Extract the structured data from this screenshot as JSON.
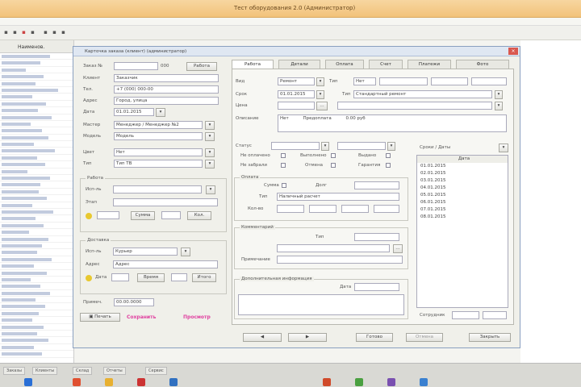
{
  "window": {
    "title": "Тест оборудования 2.0 (Администратор)"
  },
  "left_panel": {
    "header": "Наименов.",
    "row_count": 45
  },
  "dialog": {
    "title": "Карточка заказа (клиент) (администратор)",
    "left": {
      "order_label": "Заказ №",
      "order_value": "",
      "order_suffix": "000",
      "status_button": "Работа",
      "client_label": "Клиент",
      "client_value": "Заказчик",
      "phone_label": "Тел.",
      "phone_value": "+7 (000) 000-00",
      "address_label": "Адрес",
      "address_value": "Город, улица",
      "date_label": "Дата",
      "date_value": "01.01.2015",
      "master_label": "Мастер",
      "master_value": "Менеджер / Менеджер №2",
      "model_label": "Модель",
      "model_value": "Модель",
      "color_label": "Цвет",
      "color_value": "Нет",
      "type_label": "Тип",
      "type_value": "Тип ТВ",
      "group1_title": "Работа",
      "g1_field1": "Исп-ль",
      "g1_field2": "Этап",
      "g1_field3": "Сумма",
      "g1_field4": "Кол.",
      "group2_title": "Доставка",
      "g2_field1": "Исп-ль",
      "g2_field1_value": "Курьер",
      "g2_field2": "Адрес",
      "g2_field2_value": "Адрес",
      "g2_field3": "Дата",
      "g2_field4": "Время",
      "g2_field5": "Итого",
      "comment_label": "Примеч.",
      "comment_value": "00.00.0000",
      "print_button": "Печать",
      "save_link": "Сохранить",
      "print_link": "Просмотр"
    },
    "tabs": [
      "Работа",
      "Детали",
      "Оплата",
      "Счет",
      "Платежи",
      "Фото"
    ],
    "tab_panel": {
      "f1_label": "Вид",
      "f1_value": "Ремонт",
      "f1_side_label": "Тип",
      "f1_side_value": "Нет",
      "f2_label": "Срок",
      "f2_value": "01.01.2015",
      "f2_side_label": "Тип",
      "f2_side_value": "Стандартный ремонт",
      "f3_label": "Цена",
      "f3_value": "",
      "f4_label": "Описание",
      "f4_value": "Нет",
      "f4_extra": "Предоплата",
      "f4_extra2": "0.00 руб",
      "status_label": "Статус",
      "status_value": "",
      "right_group_title": "Сроки / Даты",
      "dates_header": "Дата",
      "dates": [
        "01.01.2015",
        "02.01.2015",
        "03.01.2015",
        "04.01.2015",
        "05.01.2015",
        "06.01.2015",
        "07.01.2015",
        "08.01.2015"
      ],
      "chk1": "Не оплачено",
      "chk2": "Выполнено",
      "chk3": "Выдано",
      "chk4": "Не забрали",
      "chk5": "Отмена",
      "chk6": "Гарантия",
      "group3_title": "Оплата",
      "g3_f1": "Сумма",
      "g3_f1_side": "Долг",
      "g3_f2": "Тип",
      "g3_f2_value": "Наличный расчет",
      "g3_f3": "Кол-во",
      "group4_title": "Комментарий",
      "g4_f1": "Тип",
      "g4_f2": "Примечание",
      "group5_title": "Дополнительная информация",
      "g5_f1": "Дата",
      "bottom_label": "Сотрудник"
    },
    "buttons": {
      "prev": "◀",
      "next": "▶",
      "ok": "Готово",
      "apply": "Отмена",
      "close": "Закрыть"
    }
  },
  "taskbar": {
    "items": [
      "Заказы",
      "Клиенты",
      "Склад",
      "Отчеты",
      "Сервис"
    ]
  }
}
